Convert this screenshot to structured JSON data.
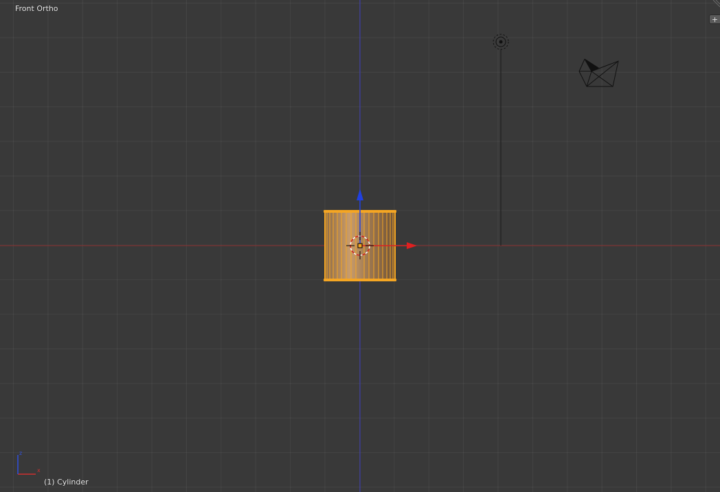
{
  "viewport": {
    "view_label": "Front Ortho",
    "object_label": "(1) Cylinder"
  },
  "buttons": {
    "region_toggle": "+"
  },
  "colors": {
    "background": "#393939",
    "grid": "#444444",
    "axis_x": "#8c2a2a",
    "axis_z": "#3a3ab8",
    "selection": "#f5a623",
    "gizmo_x": "#e02020",
    "gizmo_z": "#2040e0"
  },
  "icons": {
    "lamp": "lamp-object-icon",
    "camera": "camera-object-icon",
    "cursor": "3d-cursor-icon",
    "axes": "axis-orientation-icon"
  }
}
